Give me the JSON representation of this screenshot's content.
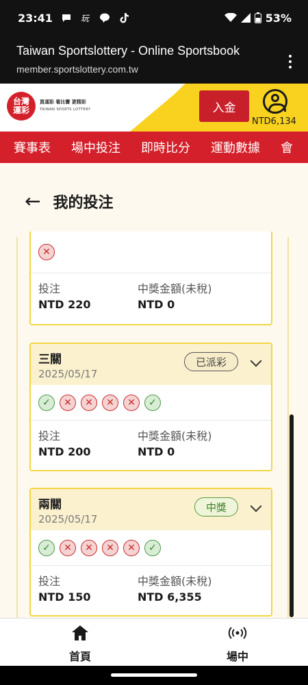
{
  "status": {
    "time": "23:41",
    "battery": "53%"
  },
  "browser": {
    "title": "Taiwan Sportslottery - Online Sportsbook",
    "url": "member.sportslottery.com.tw"
  },
  "site": {
    "logo_text": "台灣運彩",
    "slogan": "買運彩 看比賽 更精彩",
    "slogan_en": "TAIWAN SPORTS LOTTERY",
    "deposit_label": "入金",
    "balance": "NTD6,134"
  },
  "nav": {
    "items": [
      "賽事表",
      "場中投注",
      "即時比分",
      "運動數據",
      "會"
    ]
  },
  "page": {
    "title": "我的投注"
  },
  "bets": [
    {
      "type": "",
      "date": "",
      "badge": "",
      "legs": [
        "lose"
      ],
      "stake_label": "投注",
      "stake": "NTD 220",
      "payout_label": "中獎金額(未稅)",
      "payout": "NTD 0"
    },
    {
      "type": "三關",
      "date": "2025/05/17",
      "badge": "已派彩",
      "legs": [
        "win",
        "lose",
        "lose",
        "lose",
        "lose",
        "win"
      ],
      "stake_label": "投注",
      "stake": "NTD 200",
      "payout_label": "中獎金額(未稅)",
      "payout": "NTD 0"
    },
    {
      "type": "兩關",
      "date": "2025/05/17",
      "badge": "中獎",
      "legs": [
        "win",
        "lose",
        "lose",
        "lose",
        "lose",
        "win"
      ],
      "stake_label": "投注",
      "stake": "NTD 150",
      "payout_label": "中獎金額(未稅)",
      "payout": "NTD 6,355"
    }
  ],
  "bottom_nav": {
    "home_label": "首頁",
    "live_label": "場中"
  },
  "colors": {
    "brand_red": "#d4202a",
    "brand_yellow": "#f8d21f",
    "win_green": "#2e8a2e",
    "lose_red": "#c92b2b"
  }
}
